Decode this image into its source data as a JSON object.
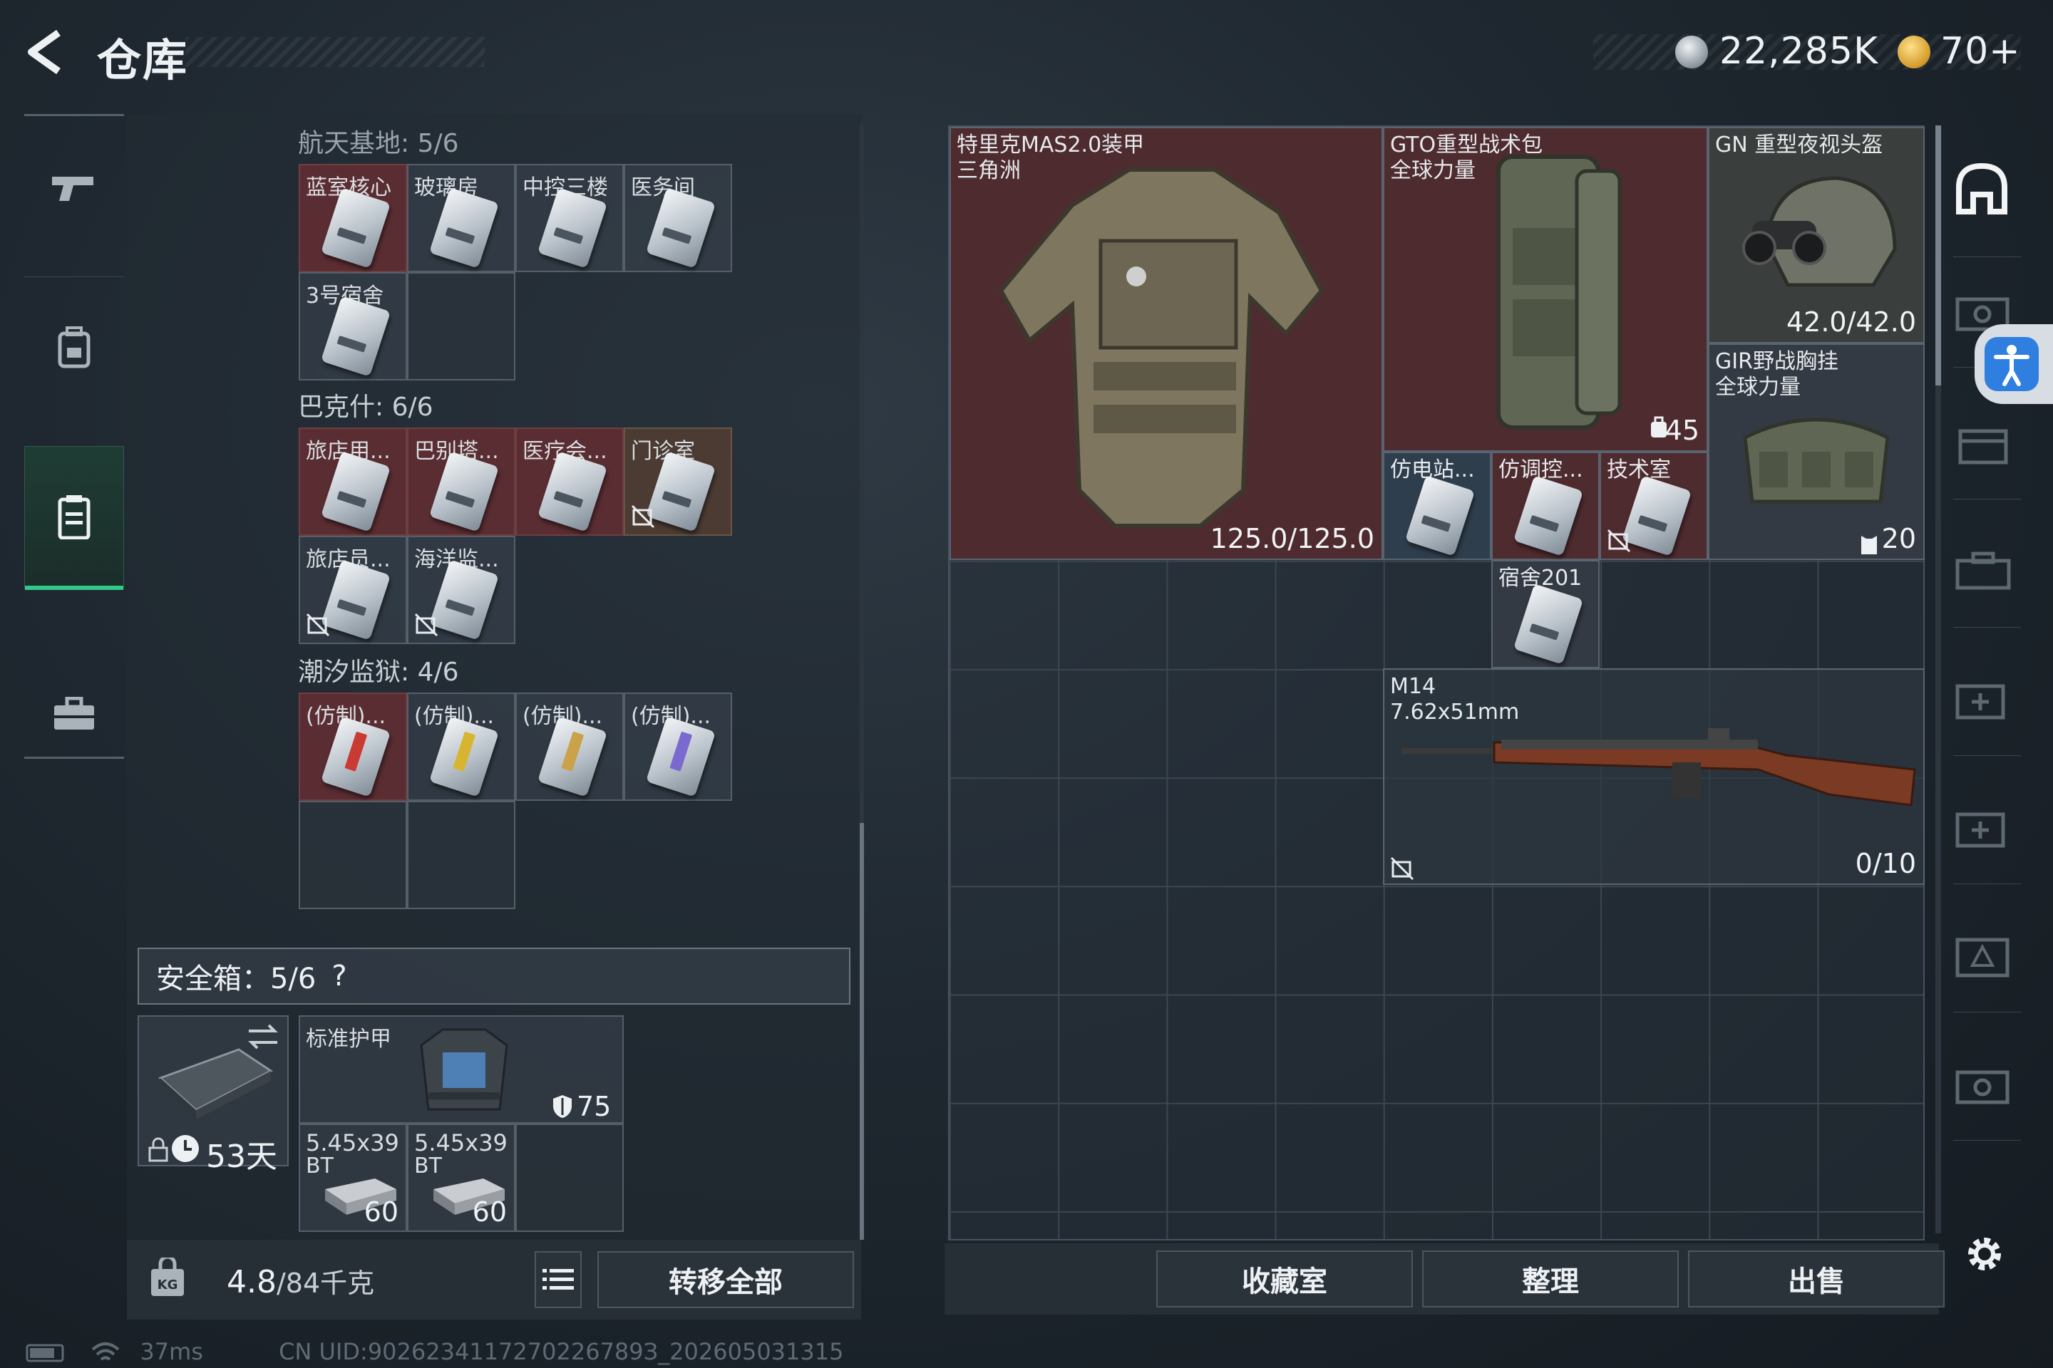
{
  "header": {
    "title": "仓库",
    "currency_silver": "22,285K",
    "currency_gold": "70+"
  },
  "nav": {
    "items": [
      "weapon",
      "backpack",
      "locker",
      "toolbox"
    ]
  },
  "left": {
    "sections": [
      {
        "title": "航天基地: 5/6",
        "cells": [
          "蓝室核心",
          "玻璃房",
          "中控三楼",
          "医务间",
          "3号宿舍"
        ]
      },
      {
        "title": "巴克什: 6/6",
        "cells": [
          "旅店用...",
          "巴别塔...",
          "医疗会...",
          "门诊室",
          "旅店员...",
          "海洋监..."
        ]
      },
      {
        "title": "潮汐监狱: 4/6",
        "cells": [
          "(仿制)...",
          "(仿制)...",
          "(仿制)...",
          "(仿制)..."
        ]
      }
    ],
    "safebox": {
      "title": "安全箱：5/6",
      "help": "?",
      "days": "53天",
      "armor": {
        "name": "标准护甲",
        "value": "75"
      },
      "ammo": [
        {
          "name": "5.45x39",
          "sub": "BT",
          "count": "60"
        },
        {
          "name": "5.45x39",
          "sub": "BT",
          "count": "60"
        }
      ]
    },
    "footer": {
      "weight": "4.8",
      "weight_max": "/84千克",
      "transfer_all": "转移全部"
    }
  },
  "right": {
    "armor": {
      "name": "特里克MAS2.0装甲",
      "sub": "三角洲",
      "durability": "125.0/125.0"
    },
    "backpack": {
      "name": "GTO重型战术包",
      "sub": "全球力量",
      "capacity": "45"
    },
    "helmet": {
      "name": "GN 重型夜视头盔",
      "durability": "42.0/42.0"
    },
    "chestrig": {
      "name": "GIR野战胸挂",
      "sub": "全球力量",
      "capacity": "20"
    },
    "keys": [
      "仿电站...",
      "仿调控...",
      "技术室",
      "宿舍201"
    ],
    "rifle": {
      "name": "M14",
      "caliber": "7.62x51mm",
      "ammo": "0/10"
    },
    "buttons": {
      "collection": "收藏室",
      "sort": "整理",
      "sell": "出售"
    }
  },
  "status": {
    "ping": "37ms",
    "uid": "CN UID:9026234117270226789З_202605031315"
  }
}
